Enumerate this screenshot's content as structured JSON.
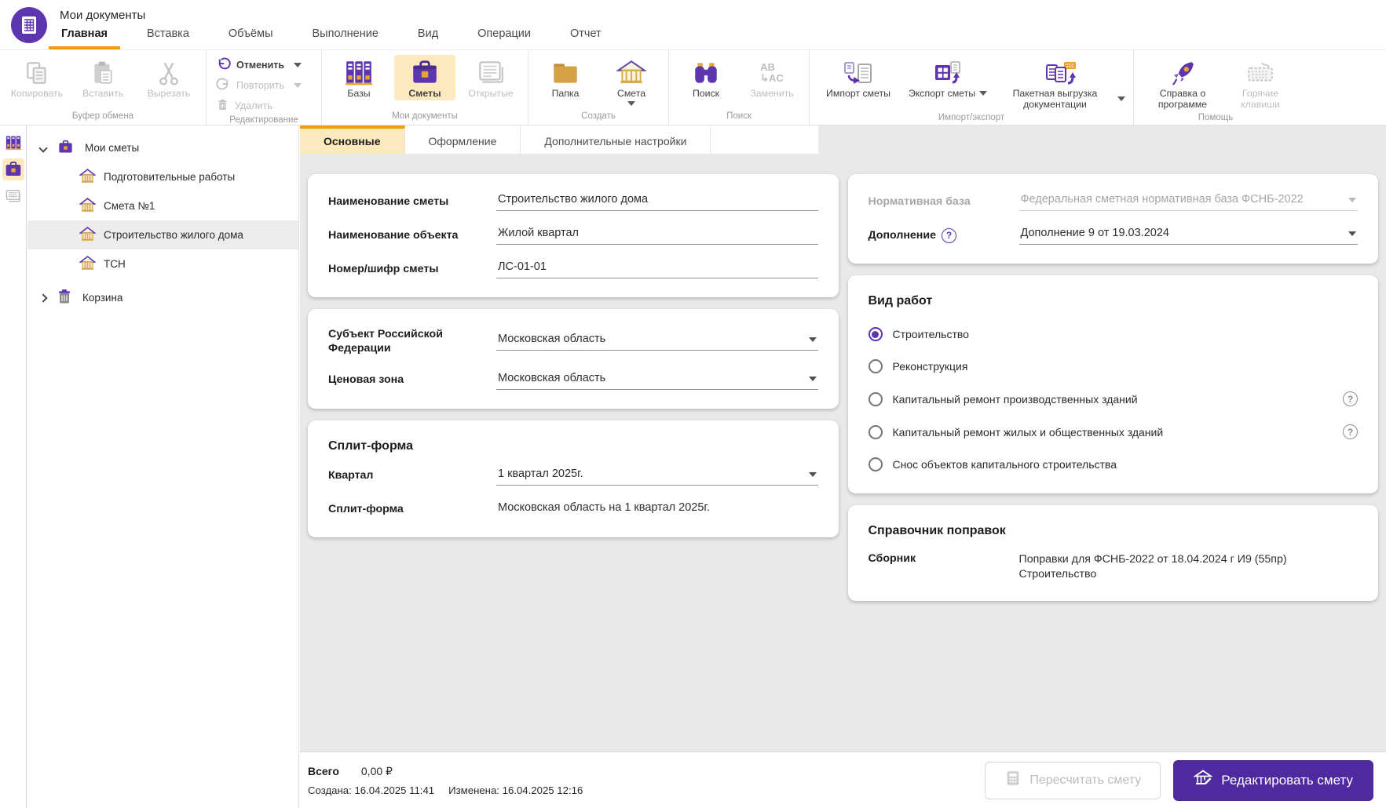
{
  "window": {
    "title": "Мои документы"
  },
  "menu": {
    "tabs": [
      {
        "label": "Главная",
        "active": true
      },
      {
        "label": "Вставка"
      },
      {
        "label": "Объёмы"
      },
      {
        "label": "Выполнение"
      },
      {
        "label": "Вид"
      },
      {
        "label": "Операции"
      },
      {
        "label": "Отчет"
      }
    ]
  },
  "ribbon": {
    "groups": [
      {
        "label": "Буфер обмена",
        "buttons": [
          {
            "label": "Копировать",
            "icon": "copy-icon",
            "disabled": true
          },
          {
            "label": "Вставить",
            "icon": "paste-icon",
            "disabled": true
          },
          {
            "label": "Вырезать",
            "icon": "scissors-icon",
            "disabled": true
          }
        ]
      },
      {
        "label": "Редактирование",
        "buttons": [
          {
            "label": "Отменить",
            "icon": "undo-icon",
            "caret": true
          },
          {
            "label": "Повторить",
            "icon": "redo-icon",
            "disabled": true,
            "caret": true
          },
          {
            "label": "Удалить",
            "icon": "trash-icon",
            "disabled": true
          }
        ]
      },
      {
        "label": "Мои документы",
        "buttons": [
          {
            "label": "Базы",
            "icon": "databases-icon"
          },
          {
            "label": "Сметы",
            "icon": "briefcase-icon",
            "selected": true
          },
          {
            "label": "Открытые",
            "icon": "open-docs-icon",
            "disabled": true
          }
        ]
      },
      {
        "label": "Создать",
        "buttons": [
          {
            "label": "Папка",
            "icon": "folder-icon"
          },
          {
            "label": "Смета",
            "icon": "estimate-house-icon",
            "caret": true
          }
        ]
      },
      {
        "label": "Поиск",
        "buttons": [
          {
            "label": "Поиск",
            "icon": "binoculars-icon"
          },
          {
            "label": "Заменить",
            "icon": "replace-icon",
            "disabled": true
          }
        ]
      },
      {
        "label": "Импорт/экспорт",
        "buttons": [
          {
            "label": "Импорт сметы",
            "icon": "import-icon"
          },
          {
            "label": "Экспорт сметы",
            "icon": "export-icon",
            "caret": true
          },
          {
            "label": "Пакетная выгрузка документации",
            "icon": "batch-export-icon",
            "caret": true
          }
        ]
      },
      {
        "label": "Помощь",
        "buttons": [
          {
            "label": "Справка о программе",
            "icon": "rocket-icon"
          },
          {
            "label": "Горячие клавиши",
            "icon": "keyboard-icon",
            "disabled": true
          }
        ]
      }
    ]
  },
  "sidebar": {
    "tree": [
      {
        "label": "Мои сметы",
        "icon": "briefcase-icon",
        "expanded": true
      },
      {
        "label": "Подготовительные работы",
        "icon": "house-icon"
      },
      {
        "label": "Смета №1",
        "icon": "house-icon"
      },
      {
        "label": "Строительство жилого дома",
        "icon": "house-icon",
        "selected": true
      },
      {
        "label": "ТСН",
        "icon": "house-icon"
      },
      {
        "label": "Корзина",
        "icon": "trash-icon",
        "collapsed": true
      }
    ]
  },
  "tabs": [
    {
      "label": "Основные",
      "active": true
    },
    {
      "label": "Оформление"
    },
    {
      "label": "Дополнительные настройки"
    }
  ],
  "form": {
    "general": {
      "fields": [
        {
          "label": "Наименование сметы",
          "value": "Строительство жилого дома"
        },
        {
          "label": "Наименование объекта",
          "value": "Жилой квартал"
        },
        {
          "label": "Номер/шифр сметы",
          "value": "ЛС-01-01"
        }
      ]
    },
    "region": {
      "fields": [
        {
          "label": "Субъект Российской Федерации",
          "value": "Московская область"
        },
        {
          "label": "Ценовая зона",
          "value": "Московская область"
        }
      ]
    },
    "split": {
      "title": "Сплит-форма",
      "quarter_label": "Квартал",
      "quarter_value": "1 квартал 2025г.",
      "split_label": "Сплит-форма",
      "split_value": "Московская область на 1 квартал 2025г."
    },
    "normative": {
      "base_label": "Нормативная база",
      "base_value": "Федеральная сметная нормативная база ФСНБ-2022",
      "addition_label": "Дополнение",
      "addition_value": "Дополнение 9 от 19.03.2024",
      "help_glyph": "?"
    },
    "worktype": {
      "title": "Вид работ",
      "options": [
        {
          "label": "Строительство",
          "selected": true
        },
        {
          "label": "Реконструкция"
        },
        {
          "label": "Капитальный ремонт производственных зданий",
          "help": true
        },
        {
          "label": "Капитальный ремонт жилых и общественных зданий",
          "help": true
        },
        {
          "label": "Снос объектов капитального строительства"
        }
      ]
    },
    "corrections": {
      "title": "Справочник поправок",
      "label": "Сборник",
      "value_line1": "Поправки для ФСНБ-2022 от 18.04.2024 г И9 (55пр)",
      "value_line2": "Строительство"
    }
  },
  "statusbar": {
    "total_label": "Всего",
    "total_value": "0,00 ₽",
    "created": "Создана: 16.04.2025 11:41",
    "modified": "Изменена: 16.04.2025 12:16",
    "recalc_button": "Пересчитать смету",
    "edit_button": "Редактировать смету"
  },
  "colors": {
    "accent": "#5E35B1",
    "accent_dark": "#4E2A9E",
    "orange": "#F59E0B",
    "selection_bg": "#FCE9BE",
    "main_bg": "#E9E9E9"
  }
}
